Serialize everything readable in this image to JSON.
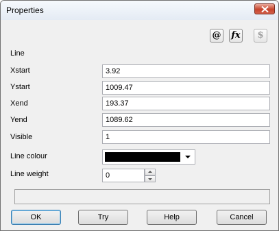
{
  "window": {
    "title": "Properties"
  },
  "toolbar": {
    "at_label": "@",
    "fx_label": "fx",
    "dollar_label": "$"
  },
  "section": {
    "title": "Line"
  },
  "fields": {
    "xstart_label": "Xstart",
    "xstart_value": "3.92",
    "ystart_label": "Ystart",
    "ystart_value": "1009.47",
    "xend_label": "Xend",
    "xend_value": "193.37",
    "yend_label": "Yend",
    "yend_value": "1089.62",
    "visible_label": "Visible",
    "visible_value": "1",
    "line_colour_label": "Line colour",
    "line_colour_value": "#000000",
    "line_weight_label": "Line weight",
    "line_weight_value": "0"
  },
  "buttons": {
    "ok": "OK",
    "try": "Try",
    "help": "Help",
    "cancel": "Cancel"
  }
}
